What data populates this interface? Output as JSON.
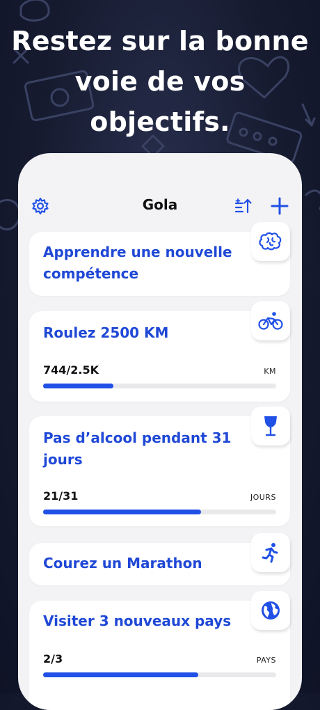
{
  "headline": [
    "Restez sur la bonne",
    "voie de vos",
    "objectifs."
  ],
  "app": {
    "title": "Gola",
    "icons": {
      "settings": "gear-icon",
      "sort": "sort-icon",
      "add": "plus-icon"
    }
  },
  "goals": [
    {
      "title": "Apprendre une nouvelle compétence",
      "icon": "brain-icon"
    },
    {
      "title": "Roulez 2500 KM",
      "icon": "bicycle-icon",
      "progress_text": "744/2.5K",
      "unit": "KM",
      "progress": 0.3
    },
    {
      "title": "Pas d’alcool pendant 31 jours",
      "icon": "wine-glass-icon",
      "progress_text": "21/31",
      "unit": "JOURS",
      "progress": 0.677
    },
    {
      "title": "Courez un Marathon",
      "icon": "runner-icon"
    },
    {
      "title": "Visiter 3 nouveaux pays",
      "icon": "globe-icon",
      "progress_text": "2/3",
      "unit": "PAYS",
      "progress": 0.667
    }
  ],
  "colors": {
    "accent": "#2050e6",
    "title": "#1f48d6",
    "background": "#161b30"
  }
}
